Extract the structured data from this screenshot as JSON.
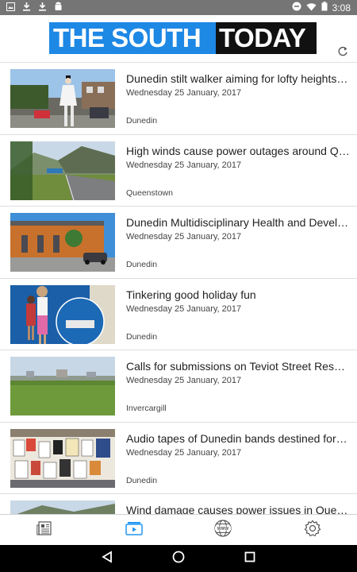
{
  "status_bar": {
    "time": "3:08",
    "left_icons": [
      "image-icon",
      "download-icon",
      "download-icon",
      "android-icon"
    ],
    "right_icons": [
      "do-not-disturb-icon",
      "wifi-icon",
      "battery-icon"
    ]
  },
  "header": {
    "logo_left": "THE SOUTH",
    "logo_right": "TODAY",
    "logo_colors": {
      "left_bg": "#1e88e5",
      "right_bg": "#111111"
    }
  },
  "articles": [
    {
      "title": "Dunedin stilt walker aiming for lofty heights i...",
      "date": "Wednesday 25 January, 2017",
      "location": "Dunedin"
    },
    {
      "title": "High winds cause power outages around Que...",
      "date": "Wednesday 25 January, 2017",
      "location": "Queenstown"
    },
    {
      "title": "Dunedin Multidisciplinary Health and Develop...",
      "date": "Wednesday 25 January, 2017",
      "location": "Dunedin"
    },
    {
      "title": "Tinkering good holiday fun",
      "date": "Wednesday 25 January, 2017",
      "location": "Dunedin"
    },
    {
      "title": "Calls for submissions on Teviot Street Reserve",
      "date": "Wednesday 25 January, 2017",
      "location": "Invercargill"
    },
    {
      "title": "Audio tapes of Dunedin bands destined for H...",
      "date": "Wednesday 25 January, 2017",
      "location": "Dunedin"
    },
    {
      "title": "Wind damage causes power issues in Quee...",
      "date": "",
      "location": ""
    }
  ],
  "bottom_nav": {
    "active_color": "#2196f3",
    "items": [
      "news-icon",
      "video-icon",
      "www-icon",
      "settings-icon"
    ],
    "active_index": 1
  }
}
